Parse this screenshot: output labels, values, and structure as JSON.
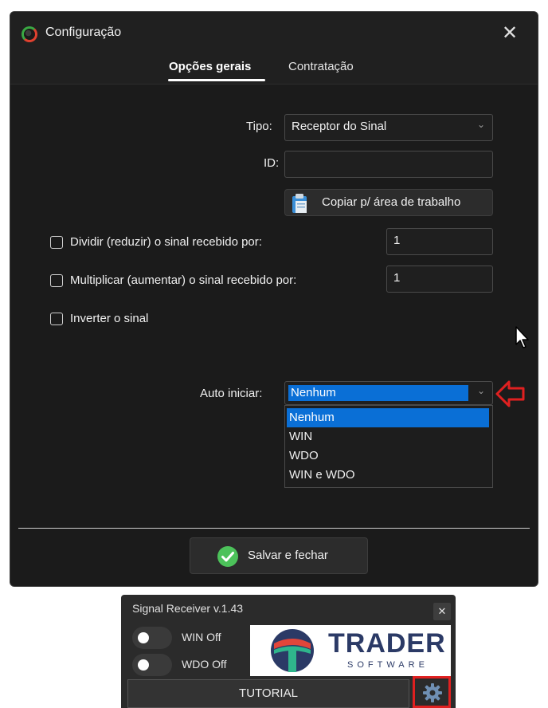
{
  "dialog": {
    "title": "Configuração",
    "close_glyph": "✕",
    "tabs": [
      {
        "label": "Opções gerais",
        "active": true
      },
      {
        "label": "Contratação",
        "active": false
      }
    ],
    "tipo_label": "Tipo:",
    "tipo_value": "Receptor do Sinal",
    "id_label": "ID:",
    "id_value": "",
    "copy_button_label": "Copiar p/ área de trabalho",
    "checks": [
      {
        "label": "Dividir (reduzir) o sinal recebido por:",
        "checked": false,
        "value": "1"
      },
      {
        "label": "Multiplicar (aumentar) o sinal recebido por:",
        "checked": false,
        "value": "1"
      },
      {
        "label": "Inverter o sinal",
        "checked": false
      }
    ],
    "auto_label": "Auto iniciar:",
    "auto_value": "Nenhum",
    "auto_options": [
      "Nenhum",
      "WIN",
      "WDO",
      "WIN e WDO"
    ],
    "save_button_label": "Salvar e fechar"
  },
  "widget": {
    "title": "Signal Receiver v.1.43",
    "close_glyph": "✕",
    "toggles": [
      {
        "label": "WIN Off",
        "on": false
      },
      {
        "label": "WDO Off",
        "on": false
      }
    ],
    "logo_word": "TRADER",
    "logo_sub": "SOFTWARE",
    "tutorial_label": "TUTORIAL"
  },
  "icons": {
    "app": "app-logo-icon",
    "clipboard": "clipboard-icon",
    "save": "check-circle-icon",
    "gear": "gear-icon",
    "arrow": "red-arrow-left-icon"
  },
  "colors": {
    "dialog_bg": "#1b1b1b",
    "selection": "#0a6fd6",
    "save_green": "#4cc25a",
    "highlight_red": "#e02020",
    "logo_blue": "#2b3a66"
  }
}
